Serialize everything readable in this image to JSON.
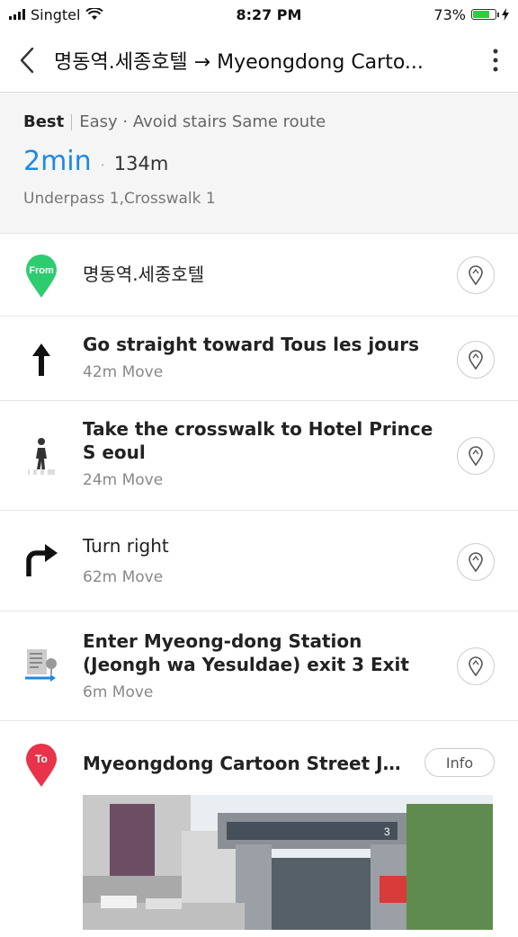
{
  "status_bar": {
    "carrier": "Singtel",
    "time": "8:27 PM",
    "battery": "73%",
    "battery_level": 0.73,
    "icons": [
      "signal-icon",
      "wifi-icon",
      "battery-icon",
      "charging-bolt-icon"
    ]
  },
  "header": {
    "title": "명동역.세종호텔 → Myeongdong Carto...",
    "icons": [
      "back-chevron-icon",
      "more-vertical-icon"
    ]
  },
  "summary": {
    "best": "Best",
    "options": "Easy · Avoid stairs Same route",
    "time": "2min",
    "dot": "·",
    "distance": "134m",
    "details": "Underpass 1,Crosswalk 1",
    "accent_color": "#1e88e5"
  },
  "from": {
    "badge": "From",
    "name": "명동역.세종호텔",
    "color": "#2ecc71"
  },
  "steps": [
    {
      "title": "Go straight toward Tous les jours",
      "sub": "42m Move",
      "icon": "straight-arrow-icon"
    },
    {
      "title": "Take the crosswalk to Hotel Prince S eoul",
      "sub": "24m Move",
      "icon": "pedestrian-crosswalk-icon"
    },
    {
      "title": "Turn right",
      "sub": "62m Move",
      "icon": "turn-right-arrow-icon"
    },
    {
      "title": "Enter Myeong-dong Station (Jeongh wa Yesuldae) exit 3 Exit",
      "sub": "6m Move",
      "icon": "station-exit-icon"
    }
  ],
  "to": {
    "badge": "To",
    "name": "Myeongdong Cartoon Street Jae...",
    "info": "Info",
    "color": "#e8334a"
  },
  "photo_sign": "3"
}
